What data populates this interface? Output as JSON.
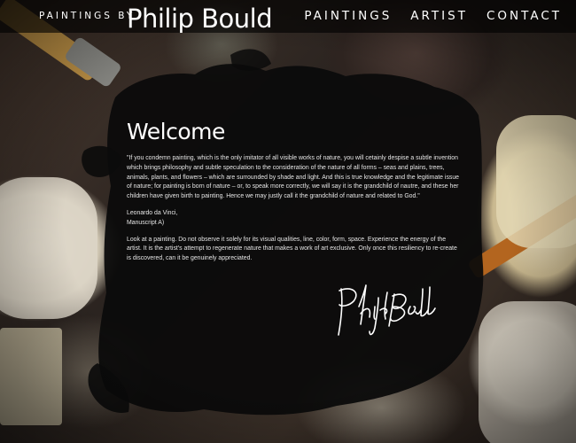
{
  "header": {
    "brand_prefix": "PAINTINGS BY",
    "brand_name": "Philip Bould",
    "nav": [
      {
        "label": "PAINTINGS"
      },
      {
        "label": "ARTIST"
      },
      {
        "label": "CONTACT"
      }
    ]
  },
  "main": {
    "heading": "Welcome",
    "quote": "\"If you condemn painting, which is the only imitator of all visible works of nature, you will cetainly despise a subtle invention which brings philosophy and subtle speculation to the consideration of the nature of all forms – seas and plains, trees, animals, plants, and flowers – which are surrounded by shade and light. And this is true knowledge and the legitimate issue of nature; for painting is born of nature – or, to speak more correctly, we will say it is the grandchild of nautre, and these her children have given birth to painting. Hence we may justly call it the grandchild of nature and related to God.\"",
    "attribution_line1": "Leonardo da Vinci,",
    "attribution_line2": "Manuscript A)",
    "statement": "Look at a painting. Do not observe it solely for its visual qualities, line, color, form, space. Experience the energy of the artist. It is the artist's attempt to regenerate nature that makes a work of art exclusive. Only once this resiliency to re-create is discovered, can it be genuinely appreciated."
  },
  "colors": {
    "header_bg": "#000000",
    "text": "#ffffff",
    "ink": "#0b0b0b"
  },
  "icons": {
    "signature": "philip-bould-signature"
  }
}
